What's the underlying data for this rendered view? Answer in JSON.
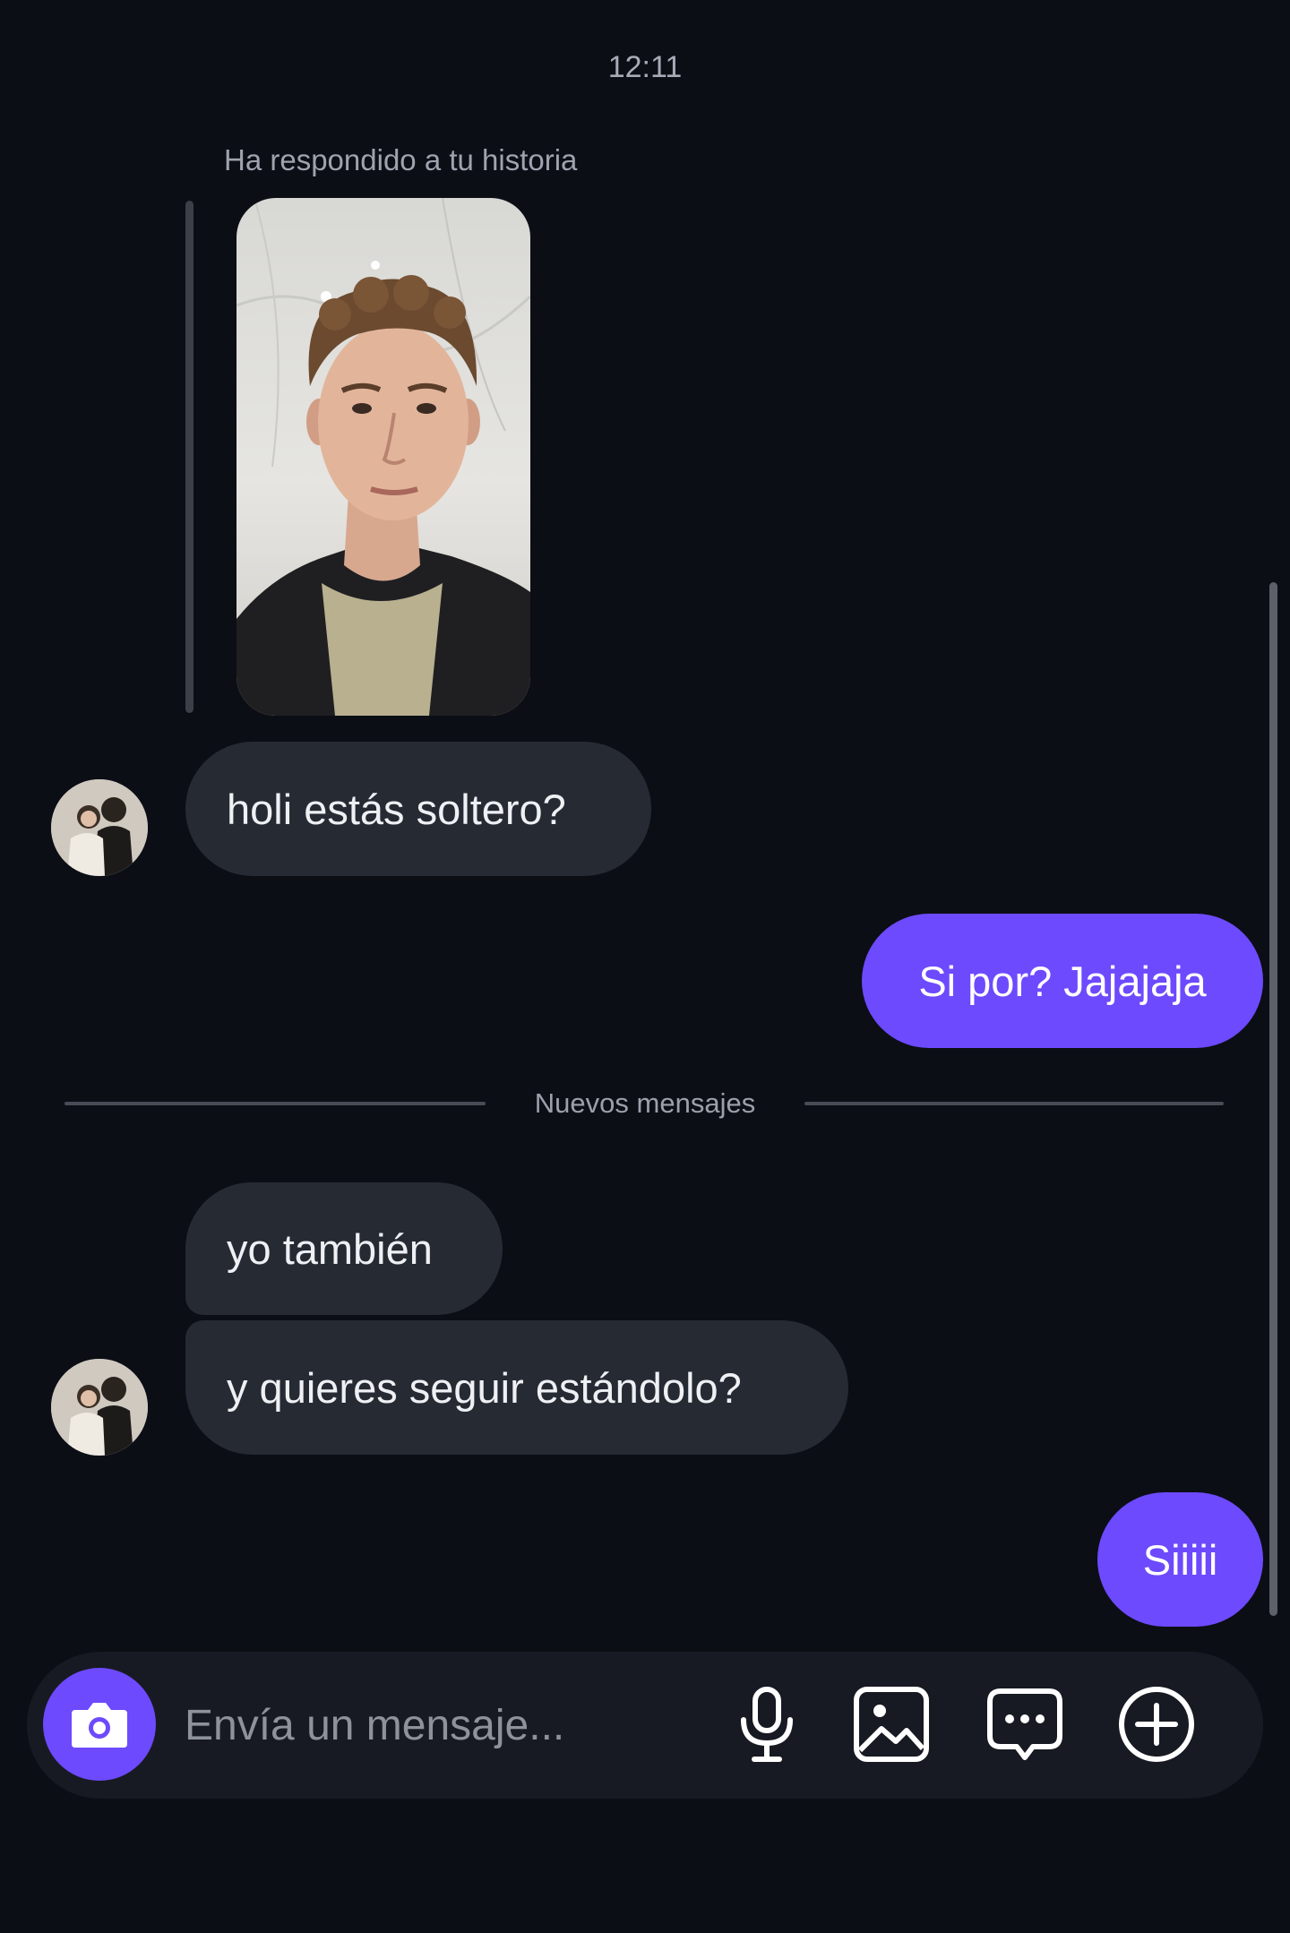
{
  "conversation": {
    "timestamp": "12:11",
    "story_reply_label": "Ha respondido a tu historia",
    "new_messages_label": "Nuevos mensajes",
    "messages": [
      {
        "from": "them",
        "text": "holi estás soltero?"
      },
      {
        "from": "me",
        "text": "Si por? Jajajaja"
      },
      {
        "from": "them",
        "text": "yo también"
      },
      {
        "from": "them",
        "text": "y quieres seguir estándolo?"
      },
      {
        "from": "me",
        "text": "Siiiii"
      }
    ]
  },
  "composer": {
    "placeholder": "Envía un mensaje...",
    "icons": [
      "camera-icon",
      "microphone-icon",
      "gallery-icon",
      "sticker-icon",
      "plus-icon"
    ]
  },
  "colors": {
    "background": "#0b0e15",
    "incoming_bubble": "#262a33",
    "outgoing_bubble": "#6d4afe",
    "accent": "#6d4afe"
  }
}
